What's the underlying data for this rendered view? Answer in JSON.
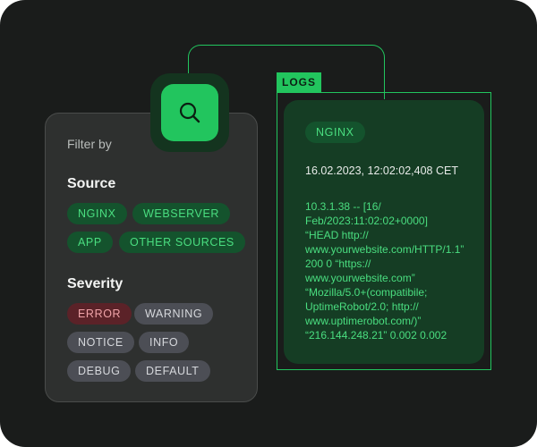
{
  "filter": {
    "title": "Filter by",
    "source": {
      "heading": "Source",
      "tags": [
        "NGINX",
        "WEBSERVER",
        "APP",
        "OTHER SOURCES"
      ]
    },
    "severity": {
      "heading": "Severity",
      "tags": [
        "ERROR",
        "WARNING",
        "NOTICE",
        "INFO",
        "DEBUG",
        "DEFAULT"
      ]
    }
  },
  "search": {
    "icon": "search-icon"
  },
  "logs": {
    "label": "LOGS",
    "source_tag": "NGINX",
    "timestamp": "16.02.2023, 12:02:02,408 CET",
    "lines": [
      "10.3.1.38 -- [16/",
      "Feb/2023:11:02:02+0000]",
      "“HEAD http://",
      "www.yourwebsite.com/HTTP/1.1”",
      "200 0 “https://",
      "www.yourwebsite.com”",
      "“Mozilla/5.0+(compatibile;",
      "UptimeRobot/2.0; http://",
      "www.uptimerobot.com/)”",
      "“216.144.248.21” 0.002 0.002"
    ]
  },
  "colors": {
    "accent": "#22c55e",
    "background": "#1a1c1b",
    "panel": "#2e302f",
    "log_card": "#153d24",
    "error": "#5b2228"
  }
}
